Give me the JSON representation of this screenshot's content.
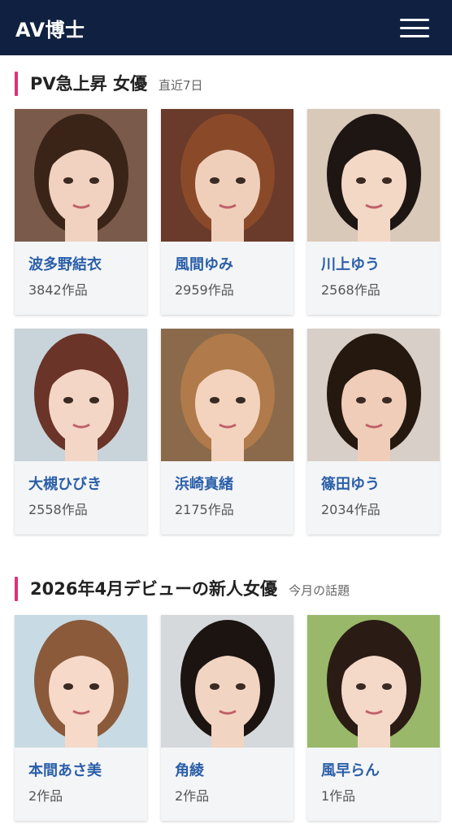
{
  "header": {
    "logo": "AV博士",
    "menu_icon": "hamburger-menu-icon"
  },
  "sections": [
    {
      "title": "PV急上昇 女優",
      "subtitle": "直近7日",
      "accent_color": "#e0307a",
      "cards": [
        {
          "name": "波多野結衣",
          "count": "3842作品",
          "bg": "#7a5a4a",
          "hair": "#3a2418",
          "skin": "#f1d2c0"
        },
        {
          "name": "風間ゆみ",
          "count": "2959作品",
          "bg": "#6a3a2a",
          "hair": "#8a4a2a",
          "skin": "#f0cfba"
        },
        {
          "name": "川上ゆう",
          "count": "2568作品",
          "bg": "#d9c9b9",
          "hair": "#1e1612",
          "skin": "#f3d8c6"
        },
        {
          "name": "大槻ひびき",
          "count": "2558作品",
          "bg": "#c9d3da",
          "hair": "#6a3428",
          "skin": "#f4d6c6"
        },
        {
          "name": "浜崎真緒",
          "count": "2175作品",
          "bg": "#8a6a4a",
          "hair": "#b07a4a",
          "skin": "#f3d3bd"
        },
        {
          "name": "篠田ゆう",
          "count": "2034作品",
          "bg": "#d8d0c8",
          "hair": "#24180f",
          "skin": "#f0cdb8"
        }
      ]
    },
    {
      "title": "2026年4月デビューの新人女優",
      "subtitle": "今月の話題",
      "accent_color": "#e0307a",
      "cards": [
        {
          "name": "本間あさ美",
          "count": "2作品",
          "bg": "#c8dae4",
          "hair": "#8a5a3a",
          "skin": "#f6d9c8"
        },
        {
          "name": "角綾",
          "count": "2作品",
          "bg": "#d6d9dc",
          "hair": "#1c1410",
          "skin": "#f2d4c2"
        },
        {
          "name": "風早らん",
          "count": "1作品",
          "bg": "#9ab86a",
          "hair": "#2a1c14",
          "skin": "#f4d8c8"
        }
      ]
    }
  ]
}
